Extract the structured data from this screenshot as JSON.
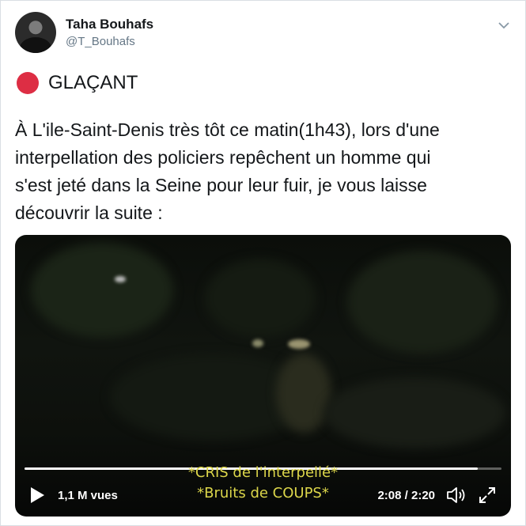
{
  "author": {
    "name": "Taha Bouhafs",
    "handle": "@T_Bouhafs"
  },
  "tweet": {
    "headline": "GLAÇANT",
    "lines": [
      "À L'ile-Saint-Denis très tôt ce matin(1h43), lors d'une",
      "interpellation des policiers repêchent un homme qui",
      "s'est jeté dans la Seine pour leur fuir, je vous laisse",
      "découvrir la suite :"
    ]
  },
  "video": {
    "subtitle_line1": "*CRIS de l'interpellé*",
    "subtitle_line2": "*Bruits de COUPS*",
    "views": "1,1 M vues",
    "time": "2:08 / 2:20",
    "progress_fraction": 0.95
  },
  "icons": {
    "menu": "chevron-down-icon",
    "status": "red-circle-emoji",
    "play": "play-icon",
    "volume": "volume-icon",
    "fullscreen": "fullscreen-icon"
  },
  "colors": {
    "red_dot": "#dd2e44",
    "handle_gray": "#657786",
    "subtitle_yellow": "#dcd64a"
  }
}
